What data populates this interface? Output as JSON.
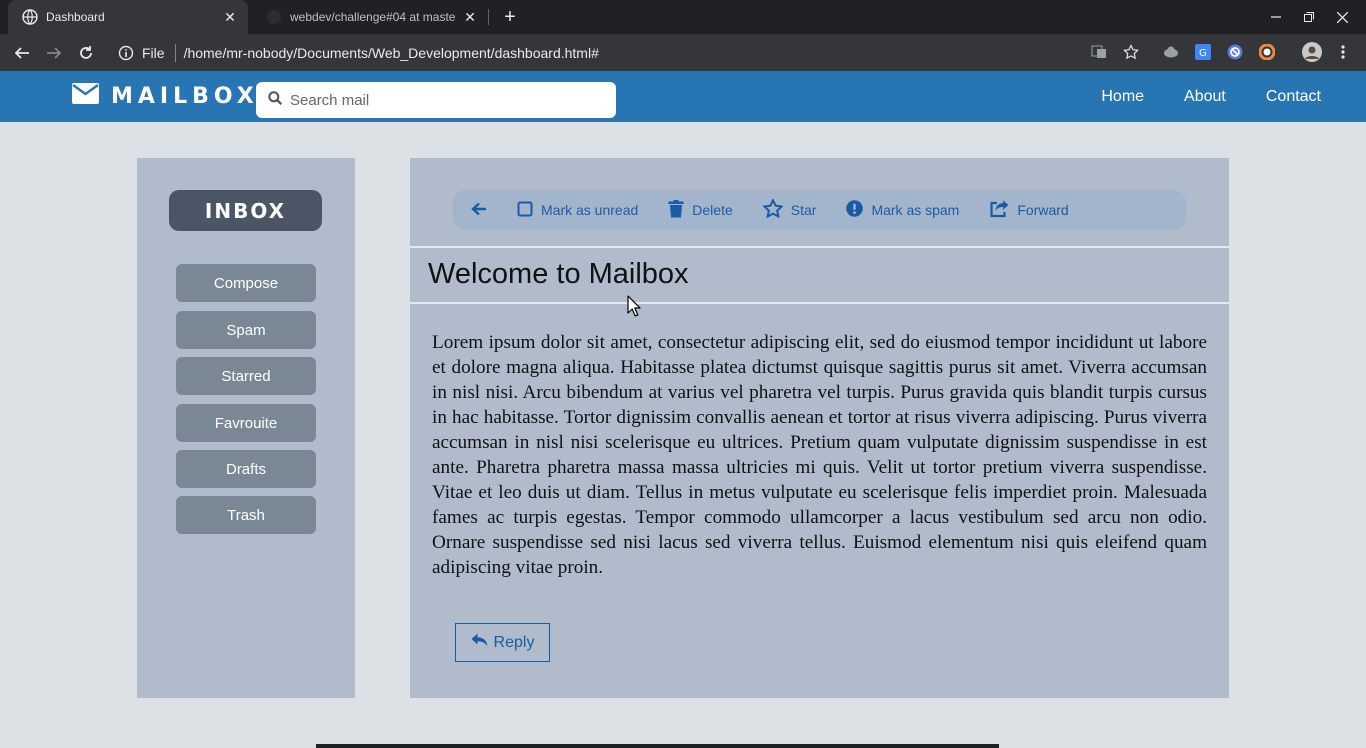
{
  "browser": {
    "tabs": [
      {
        "title": "Dashboard",
        "active": true
      },
      {
        "title": "webdev/challenge#04 at maste",
        "active": false
      }
    ],
    "omnibox": {
      "scheme_label": "File",
      "url": "/home/mr-nobody/Documents/Web_Development/dashboard.html#"
    }
  },
  "header": {
    "brand": "MAILBOX",
    "search_placeholder": "Search mail",
    "nav": [
      "Home",
      "About",
      "Contact"
    ]
  },
  "sidebar": {
    "heading": "INBOX",
    "items": [
      "Compose",
      "Spam",
      "Starred",
      "Favrouite",
      "Drafts",
      "Trash"
    ]
  },
  "toolbar": {
    "mark_unread": "Mark as unread",
    "delete": "Delete",
    "star": "Star",
    "mark_spam": "Mark as spam",
    "forward": "Forward"
  },
  "message": {
    "subject": "Welcome to Mailbox",
    "body": "Lorem ipsum dolor sit amet, consectetur adipiscing elit, sed do eiusmod tempor incididunt ut labore et dolore magna aliqua. Habitasse platea dictumst quisque sagittis purus sit amet. Viverra accumsan in nisl nisi. Arcu bibendum at varius vel pharetra vel turpis. Purus gravida quis blandit turpis cursus in hac habitasse. Tortor dignissim convallis aenean et tortor at risus viverra adipiscing. Purus viverra accumsan in nisl nisi scelerisque eu ultrices. Pretium quam vulputate dignissim suspendisse in est ante. Pharetra pharetra massa massa ultricies mi quis. Velit ut tortor pretium viverra suspendisse. Vitae et leo duis ut diam. Tellus in metus vulputate eu scelerisque felis imperdiet proin. Malesuada fames ac turpis egestas. Tempor commodo ullamcorper a lacus vestibulum sed arcu non odio. Ornare suspendisse sed nisi lacus sed viverra tellus. Euismod elementum nisi quis eleifend quam adipiscing vitae proin.",
    "reply_label": "Reply"
  },
  "colors": {
    "header_bg": "#2775b2",
    "panel_bg": "#b0bccc",
    "page_bg": "#dce1e5",
    "accent": "#1a5ca3",
    "inbox_bg": "#4a5565",
    "nav_button_bg": "#7a8896"
  },
  "icons": {
    "brand": "envelope-icon",
    "search": "search-icon",
    "back": "arrow-left-icon",
    "mark_unread": "square-icon",
    "delete": "trash-icon",
    "star": "star-icon",
    "mark_spam": "exclamation-circle-icon",
    "forward": "share-icon",
    "reply": "reply-icon"
  }
}
